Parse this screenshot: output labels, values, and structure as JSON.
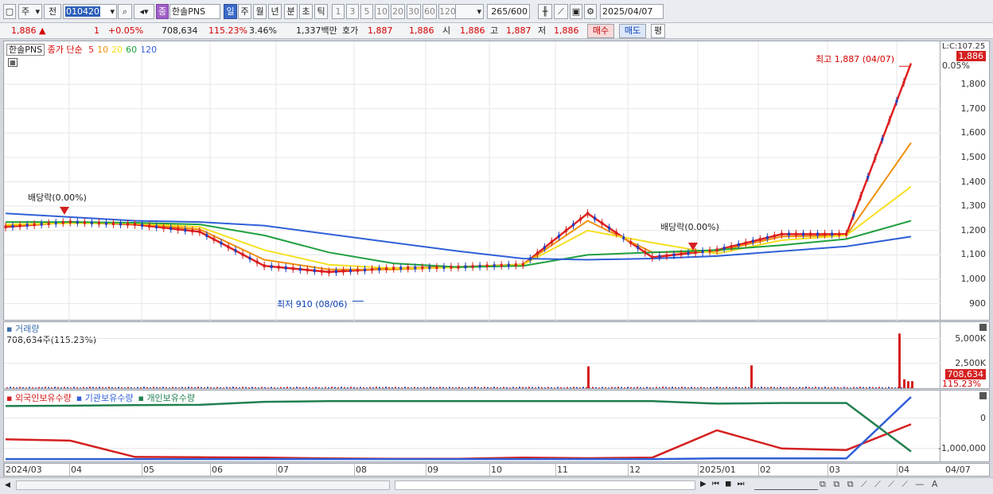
{
  "toolbar": {
    "market_type": "주",
    "period_type": "전",
    "stock_code": "010420",
    "stock_name": "한솔PNS",
    "badge_jong": "종",
    "period_tabs": [
      "일",
      "주",
      "월",
      "년",
      "분",
      "초",
      "틱"
    ],
    "interval_tabs": [
      "1",
      "3",
      "5",
      "10",
      "20",
      "30",
      "60",
      "120"
    ],
    "count": "265",
    "count_max": "/600",
    "date": "2025/04/07"
  },
  "quote": {
    "price": "1,886",
    "change": "1",
    "change_pct": "+0.05%",
    "volume": "708,634",
    "volume_ratio": "115.23%",
    "turnover": "3.46%",
    "amount": "1,337백만",
    "ask_label": "호가",
    "ask": "1,887",
    "bid": "1,886",
    "open_label": "시",
    "open": "1,886",
    "high_label": "고",
    "high": "1,887",
    "low_label": "저",
    "low": "1,886",
    "buy_label": "매수",
    "sell_label": "매도",
    "avg_label": "평"
  },
  "price_panel": {
    "legend_name": "한솔PNS",
    "legend_ma_label": "종가 단순",
    "ma_periods": [
      "5",
      "10",
      "20",
      "60",
      "120"
    ],
    "ma_colors": [
      "#e02020",
      "#f0900a",
      "#f5e020",
      "#20a040",
      "#3060d8"
    ],
    "axis_top_label": "L:C:107.25",
    "current_price_tag": "1,886",
    "pct_tag": "0.05%",
    "high_annotation": "최고 1,887 (04/07)",
    "low_annotation": "최저 910 (08/06)",
    "dividend_label_1": "배당락(0.00%)",
    "dividend_label_2": "배당락(0.00%)"
  },
  "volume_panel": {
    "title": "거래량",
    "subtitle": "708,634주(115.23%)",
    "volume_tag": "708,634",
    "ratio_tag": "115.23%"
  },
  "holdings_panel": {
    "legend": [
      "외국인보유수량",
      "기관보유수량",
      "개인보유수량"
    ],
    "colors": [
      "#d42020",
      "#3060d8",
      "#208050"
    ]
  },
  "chart_data": [
    {
      "type": "line",
      "subtype": "candlestick-with-moving-averages",
      "ylim": [
        850,
        1950
      ],
      "yticks": [
        900,
        1000,
        1100,
        1200,
        1300,
        1400,
        1500,
        1600,
        1700,
        1800
      ],
      "x_labels": [
        "2024/03",
        "04",
        "05",
        "06",
        "07",
        "08",
        "09",
        "10",
        "11",
        "12",
        "2025/01",
        "02",
        "03",
        "04"
      ],
      "series": [
        {
          "name": "5",
          "values": [
            1215,
            1235,
            1225,
            1195,
            1055,
            1030,
            1045,
            1050,
            1060,
            1270,
            1090,
            1120,
            1185,
            1185,
            1886
          ]
        },
        {
          "name": "10",
          "values": [
            1220,
            1232,
            1228,
            1205,
            1080,
            1040,
            1040,
            1050,
            1060,
            1240,
            1110,
            1115,
            1175,
            1180,
            1560
          ]
        },
        {
          "name": "20",
          "values": [
            1225,
            1230,
            1230,
            1215,
            1120,
            1060,
            1045,
            1048,
            1060,
            1200,
            1150,
            1105,
            1160,
            1180,
            1380
          ]
        },
        {
          "name": "60",
          "values": [
            1235,
            1235,
            1232,
            1225,
            1180,
            1110,
            1065,
            1050,
            1055,
            1100,
            1110,
            1120,
            1140,
            1165,
            1240
          ]
        },
        {
          "name": "120",
          "values": [
            1270,
            1255,
            1240,
            1235,
            1220,
            1185,
            1150,
            1115,
            1085,
            1080,
            1085,
            1095,
            1115,
            1135,
            1175
          ]
        }
      ],
      "annotations": [
        {
          "label": "최고 1,887 (04/07)",
          "value": 1887
        },
        {
          "label": "최저 910 (08/06)",
          "value": 910
        }
      ]
    },
    {
      "type": "bar",
      "title": "거래량",
      "yticks": [
        "5,000K",
        "2,500K"
      ],
      "ylim": [
        0,
        6000
      ],
      "spikes_k": [
        {
          "at": "11월 중순",
          "value": 2200
        },
        {
          "at": "2025/01 말",
          "value": 2300
        },
        {
          "at": "04",
          "value": 5500
        }
      ],
      "latest_k": 708.634
    },
    {
      "type": "line",
      "title": "외국인보유수량 / 기관보유수량 / 개인보유수량",
      "yticks": [
        "0",
        "-1,000,000"
      ],
      "series": [
        {
          "name": "외국인보유수량",
          "values": [
            -700000,
            -740000,
            -1280000,
            -1290000,
            -1300000,
            -1330000,
            -1340000,
            -1340000,
            -1300000,
            -1320000,
            -1300000,
            -400000,
            -1000000,
            -1050000,
            -200000
          ]
        },
        {
          "name": "기관보유수량",
          "values": [
            -1350000,
            -1350000,
            -1350000,
            -1350000,
            -1350000,
            -1350000,
            -1350000,
            -1350000,
            -1350000,
            -1350000,
            -1350000,
            -1330000,
            -1330000,
            -1330000,
            700000
          ]
        },
        {
          "name": "개인보유수량",
          "values": [
            400000,
            410000,
            430000,
            440000,
            540000,
            560000,
            560000,
            560000,
            560000,
            560000,
            560000,
            480000,
            500000,
            500000,
            -1100000
          ]
        }
      ]
    }
  ]
}
